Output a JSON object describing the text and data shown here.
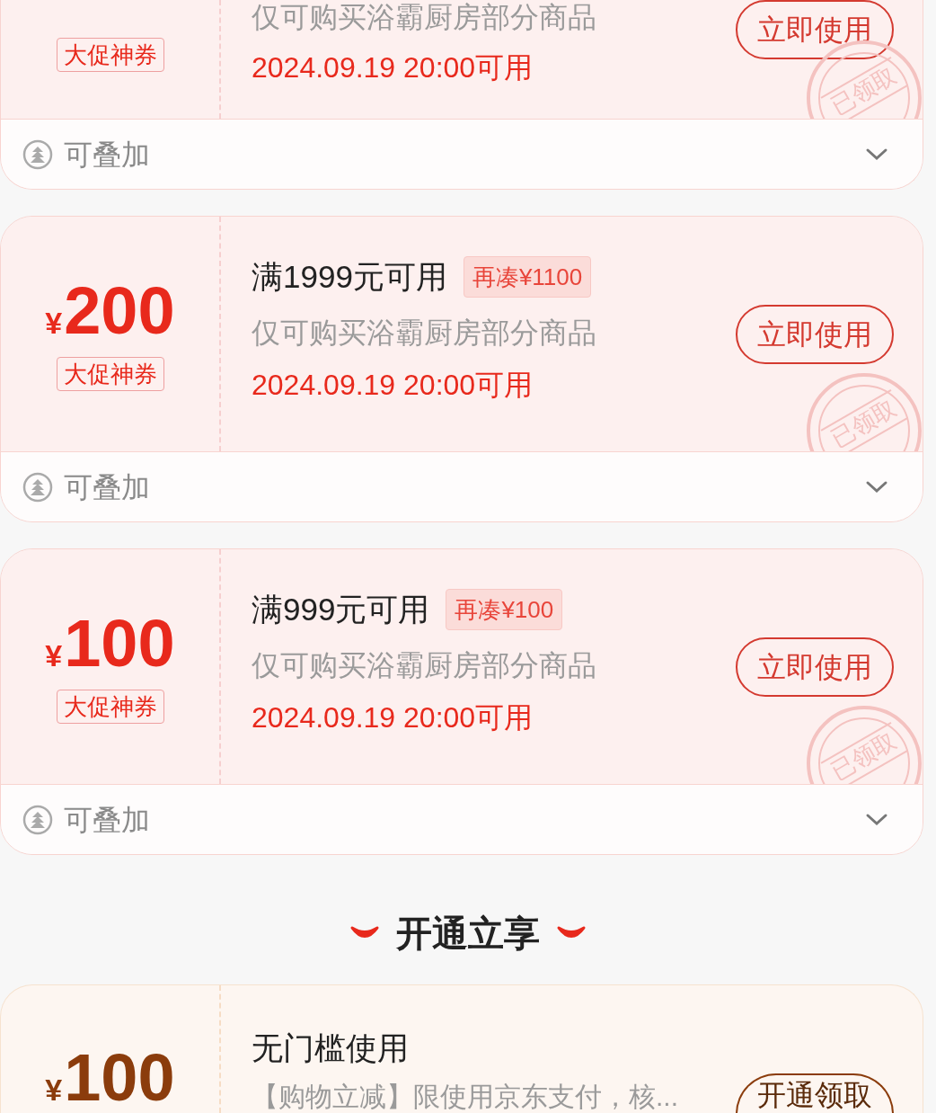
{
  "coupons": [
    {
      "kind": "partial",
      "badge": "大促神券",
      "description": "仅可购买浴霸厨房部分商品",
      "date": "2024.09.19 20:00可用",
      "button": "立即使用",
      "stamp": "已领取",
      "footer": {
        "label": "可叠加",
        "expanded": false
      }
    },
    {
      "kind": "full",
      "currency": "¥",
      "amount": "200",
      "badge": "大促神券",
      "condition": "满1999元可用",
      "extra": "再凑¥1100",
      "description": "仅可购买浴霸厨房部分商品",
      "date": "2024.09.19 20:00可用",
      "button": "立即使用",
      "stamp": "已领取",
      "footer": {
        "label": "可叠加",
        "expanded": false
      }
    },
    {
      "kind": "full",
      "currency": "¥",
      "amount": "100",
      "badge": "大促神券",
      "condition": "满999元可用",
      "extra": "再凑¥100",
      "description": "仅可购买浴霸厨房部分商品",
      "date": "2024.09.19 20:00可用",
      "button": "立即使用",
      "stamp": "已领取",
      "footer": {
        "label": "可叠加",
        "expanded": false
      }
    }
  ],
  "section": {
    "title": "开通立享"
  },
  "member_coupons": [
    {
      "kind": "member",
      "currency": "¥",
      "amount": "100",
      "condition": "无门槛使用",
      "description": "【购物立减】限使用京东支付，核...",
      "button": "开通领取"
    }
  ]
}
